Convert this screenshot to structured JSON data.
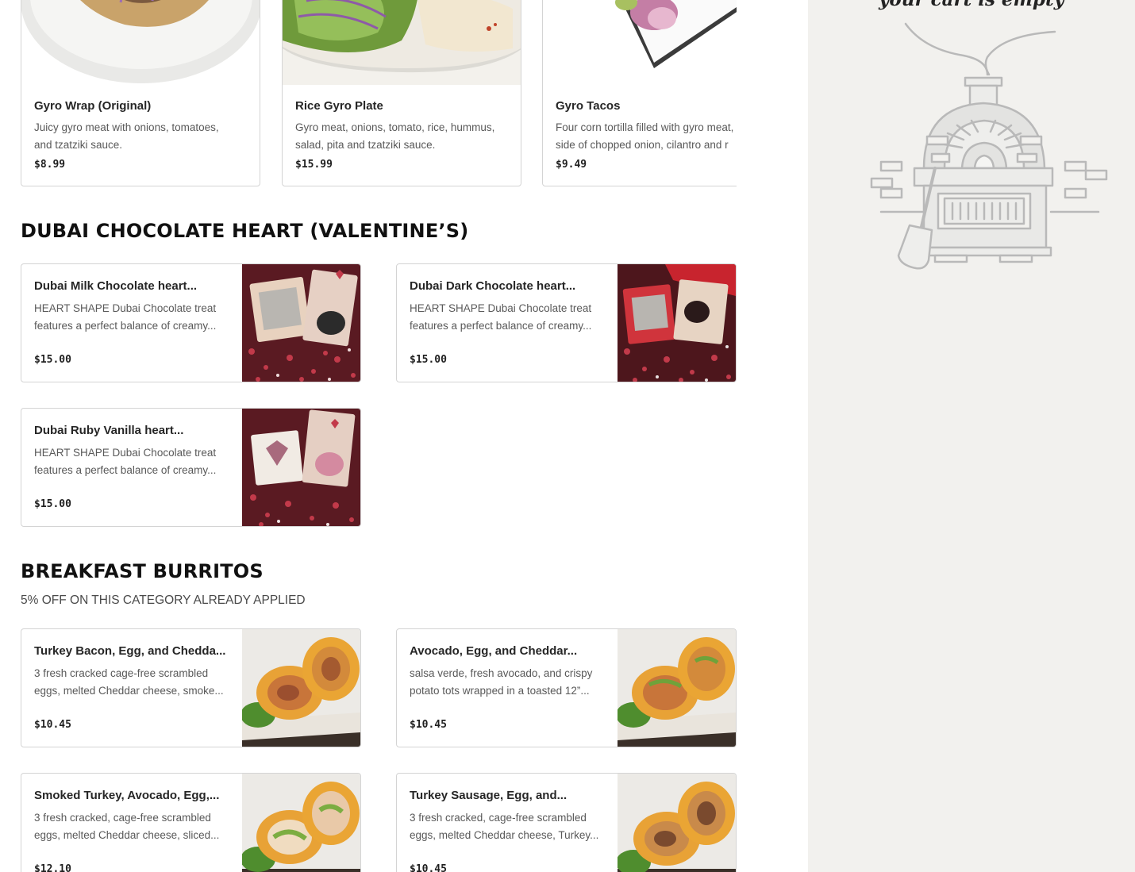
{
  "carousel": {
    "items": [
      {
        "name": "Gyro Wrap (Original)",
        "desc1": "Juicy gyro meat with onions, tomatoes,",
        "desc2": "and tzatziki sauce.",
        "price": "$8.99"
      },
      {
        "name": "Rice Gyro Plate",
        "desc1": "Gyro meat, onions, tomato, rice, hummus,",
        "desc2": "salad, pita and tzatziki sauce.",
        "price": "$15.99"
      },
      {
        "name": "Gyro Tacos",
        "desc1": "Four corn tortilla filled with gyro meat,",
        "desc2": "side of chopped onion, cilantro and r",
        "price": "$9.49"
      }
    ]
  },
  "sections": {
    "valentines": {
      "title": "DUBAI CHOCOLATE HEART (VALENTINE’S)",
      "items": [
        {
          "name": "Dubai Milk Chocolate heart...",
          "desc1": "HEART SHAPE Dubai Chocolate treat",
          "desc2": "features a perfect balance of creamy...",
          "price": "$15.00"
        },
        {
          "name": "Dubai Dark Chocolate heart...",
          "desc1": "HEART SHAPE Dubai Chocolate treat",
          "desc2": "features a perfect balance of creamy...",
          "price": "$15.00"
        },
        {
          "name": "Dubai Ruby Vanilla heart...",
          "desc1": "HEART SHAPE Dubai Chocolate treat",
          "desc2": "features a perfect balance of creamy...",
          "price": "$15.00"
        }
      ]
    },
    "burritos": {
      "title": "BREAKFAST BURRITOS",
      "subtitle": "5% OFF ON THIS CATEGORY ALREADY APPLIED",
      "items": [
        {
          "name": "Turkey Bacon, Egg, and Chedda...",
          "desc1": "3 fresh cracked cage-free scrambled",
          "desc2": "eggs, melted Cheddar cheese, smoke...",
          "price": "$10.45"
        },
        {
          "name": "Avocado, Egg, and Cheddar...",
          "desc1": "salsa verde, fresh avocado, and crispy",
          "desc2": "potato tots wrapped in a toasted 12”...",
          "price": "$10.45"
        },
        {
          "name": "Smoked Turkey, Avocado, Egg,...",
          "desc1": "3 fresh cracked, cage-free scrambled",
          "desc2": "eggs, melted Cheddar cheese, sliced...",
          "price": "$12.10"
        },
        {
          "name": "Turkey Sausage, Egg, and...",
          "desc1": "3 fresh cracked, cage-free scrambled",
          "desc2": "eggs, melted Cheddar cheese, Turkey...",
          "price": "$10.45"
        }
      ]
    }
  },
  "cart": {
    "empty_text": "your cart is empty",
    "illustration": "pizza-oven-illustration"
  },
  "colors": {
    "cart_panel_bg": "#f2f1ee",
    "card_border": "#d4d4d4",
    "text_primary": "#1f1f1f",
    "text_secondary": "#595959"
  }
}
